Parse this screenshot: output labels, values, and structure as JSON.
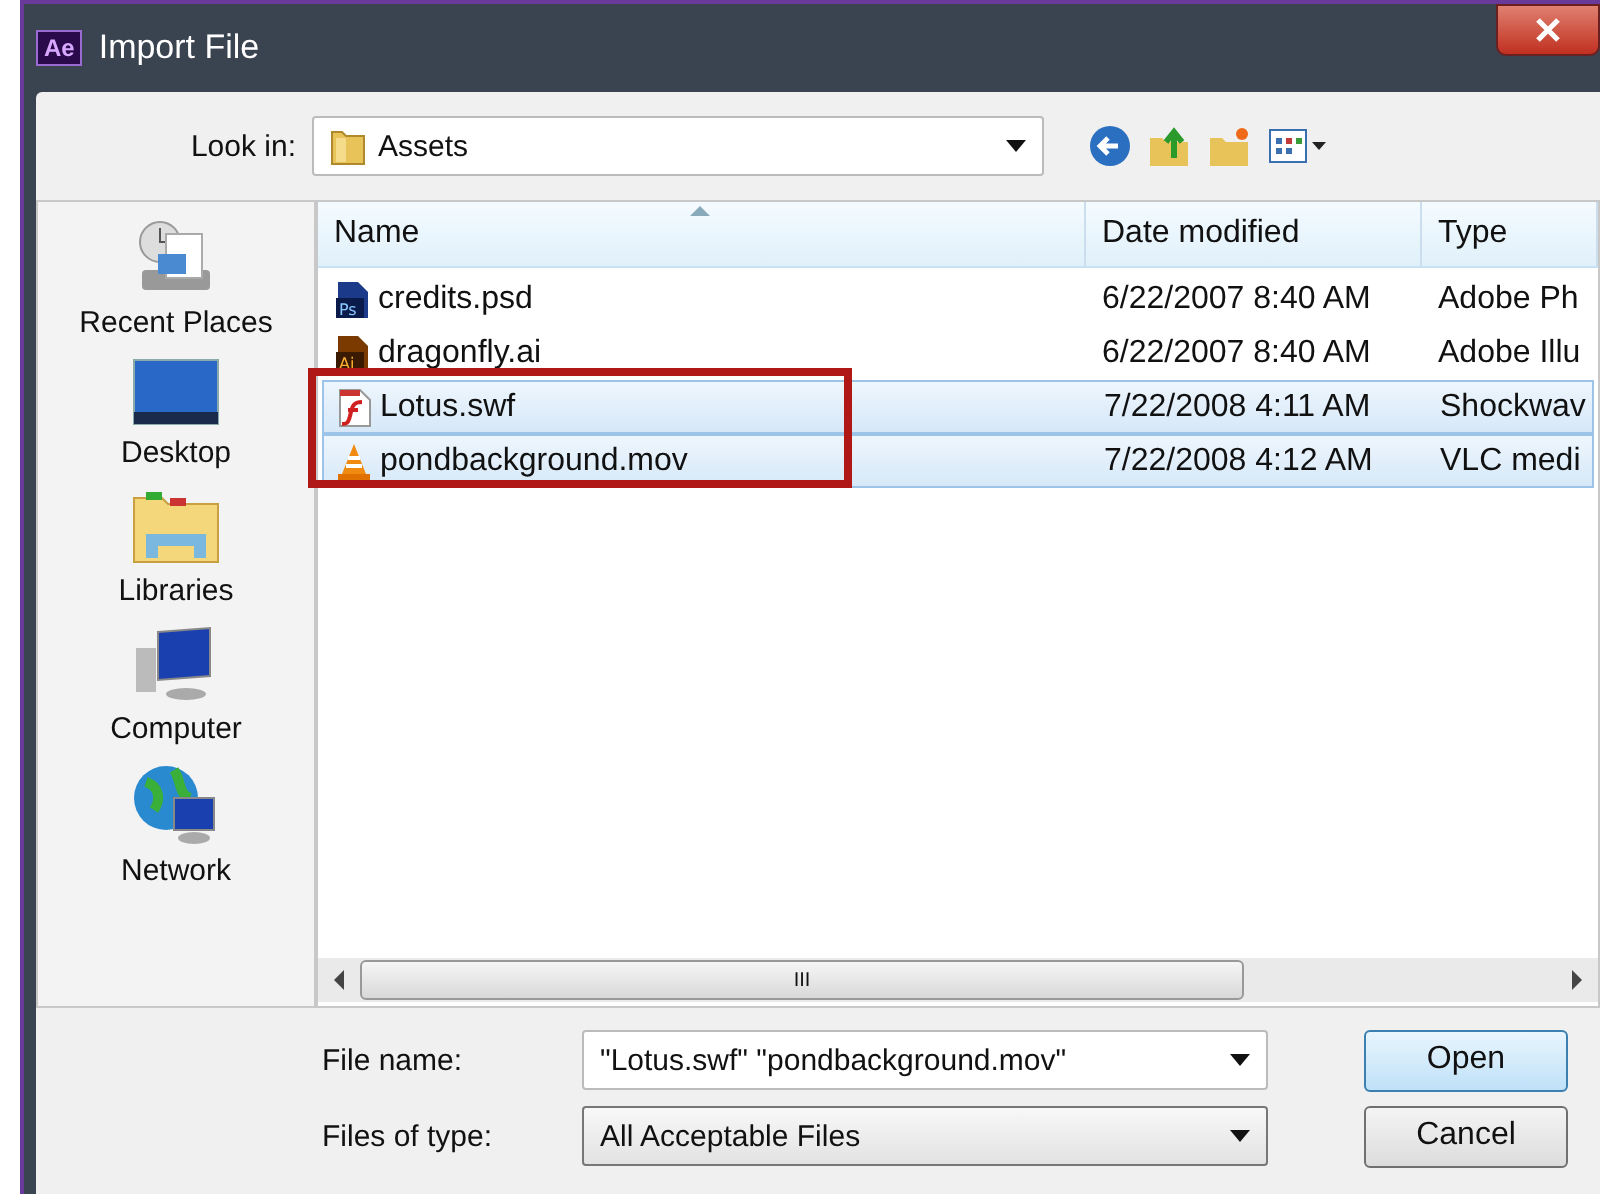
{
  "window": {
    "title": "Import File",
    "app_badge": "Ae"
  },
  "look_in": {
    "label": "Look in:",
    "value": "Assets"
  },
  "sidebar": {
    "items": [
      {
        "label": "Recent Places",
        "kind": "recent"
      },
      {
        "label": "Desktop",
        "kind": "desktop"
      },
      {
        "label": "Libraries",
        "kind": "libraries"
      },
      {
        "label": "Computer",
        "kind": "computer"
      },
      {
        "label": "Network",
        "kind": "network"
      }
    ]
  },
  "table": {
    "columns": [
      "Name",
      "Date modified",
      "Type"
    ],
    "rows": [
      {
        "name": "credits.psd",
        "kind": "psd",
        "badge": "Ps",
        "date": "6/22/2007 8:40 AM",
        "type": "Adobe Ph",
        "selected": false
      },
      {
        "name": "dragonfly.ai",
        "kind": "ai",
        "badge": "Ai",
        "date": "6/22/2007 8:40 AM",
        "type": "Adobe Illu",
        "selected": false
      },
      {
        "name": "Lotus.swf",
        "kind": "swf",
        "date": "7/22/2008 4:11 AM",
        "type": "Shockwav",
        "selected": true
      },
      {
        "name": "pondbackground.mov",
        "kind": "mov",
        "date": "7/22/2008 4:12 AM",
        "type": "VLC medi",
        "selected": true
      }
    ]
  },
  "scrollbar_grip": "III",
  "file_name": {
    "label": "File name:",
    "value": "\"Lotus.swf\" \"pondbackground.mov\""
  },
  "file_type": {
    "label": "Files of type:",
    "value": "All Acceptable Files"
  },
  "buttons": [
    "Open",
    "Cancel"
  ]
}
